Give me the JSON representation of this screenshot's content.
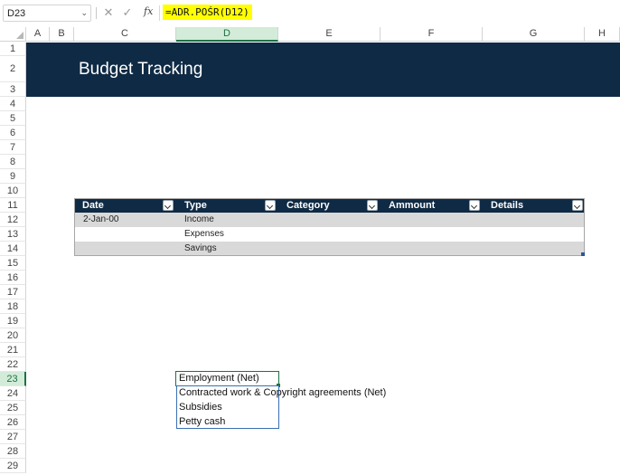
{
  "formula_bar": {
    "name_box": "D23",
    "cancel_icon": "x-icon",
    "enter_icon": "check-icon",
    "fx_label": "fx",
    "formula": "=ADR.POŚR(D12)"
  },
  "columns": [
    "A",
    "B",
    "C",
    "D",
    "E",
    "F",
    "G",
    "H"
  ],
  "rows": [
    "1",
    "2",
    "3",
    "4",
    "5",
    "6",
    "7",
    "8",
    "9",
    "10",
    "11",
    "12",
    "13",
    "14",
    "15",
    "16",
    "17",
    "18",
    "19",
    "20",
    "21",
    "22",
    "23",
    "24",
    "25",
    "26",
    "27",
    "28",
    "29"
  ],
  "selected": {
    "column": "D",
    "row": "23"
  },
  "banner": {
    "title": "Budget Tracking",
    "color": "#0f2a44"
  },
  "table": {
    "headers": [
      "Date",
      "Type",
      "Category",
      "Ammount",
      "Details"
    ],
    "rows": [
      {
        "date": "2-Jan-00",
        "type": "Income"
      },
      {
        "date": "",
        "type": "Expenses"
      },
      {
        "date": "",
        "type": "Savings"
      }
    ],
    "band_color": "#d9d9d9"
  },
  "dropdown": {
    "items": [
      "Employment (Net)",
      "Contracted work & Copyright agreements (Net)",
      "Subsidies",
      "Petty cash"
    ]
  },
  "colors": {
    "selection": "#1e7145",
    "formula_highlight": "#ffff00",
    "list_border": "#3a6fb5"
  }
}
